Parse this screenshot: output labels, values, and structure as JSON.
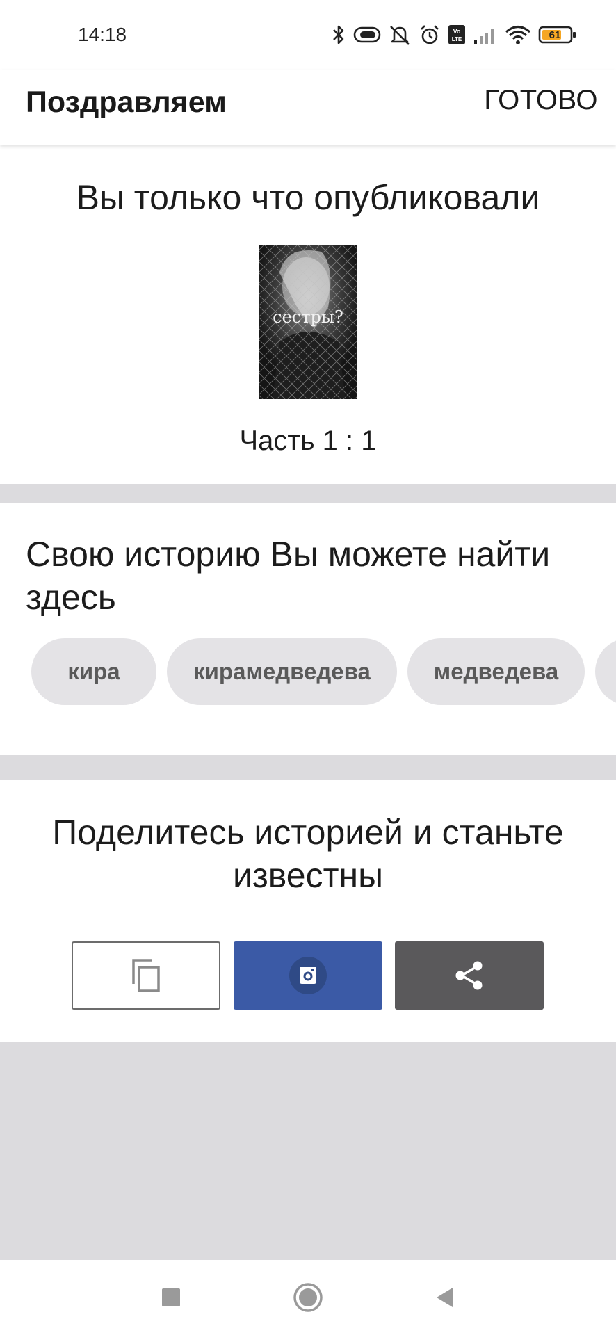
{
  "status_bar": {
    "time": "14:18",
    "battery_level": "61",
    "icons": [
      "bluetooth-icon",
      "toggle-icon",
      "mute-icon",
      "alarm-icon",
      "volte-icon",
      "signal-icon",
      "wifi-icon",
      "battery-icon"
    ],
    "battery_color": "#f5a623"
  },
  "app_bar": {
    "title": "Поздравляем",
    "done_label": "ГОТОВО"
  },
  "published": {
    "heading": "Вы только что опубликовали",
    "cover_title": "сестры?",
    "part_label": "Часть 1 : 1"
  },
  "find_story": {
    "heading": "Свою историю Вы можете найти здесь",
    "tags": [
      "кира",
      "кирамедведева",
      "медведева",
      ""
    ]
  },
  "share": {
    "heading": "Поделитесь историей и станьте известны",
    "buttons": [
      {
        "name": "copy",
        "icon": "copy-icon"
      },
      {
        "name": "instagram",
        "icon": "instagram-icon",
        "color": "#3b5aa6"
      },
      {
        "name": "share",
        "icon": "share-icon",
        "color": "#5a595b"
      }
    ]
  },
  "nav_bar": {
    "icons": [
      "recents-square-icon",
      "home-circle-icon",
      "back-triangle-icon"
    ]
  },
  "colors": {
    "background": "#dcdbde",
    "tag_background": "#e4e3e6",
    "tag_text": "#5a5a5a"
  }
}
